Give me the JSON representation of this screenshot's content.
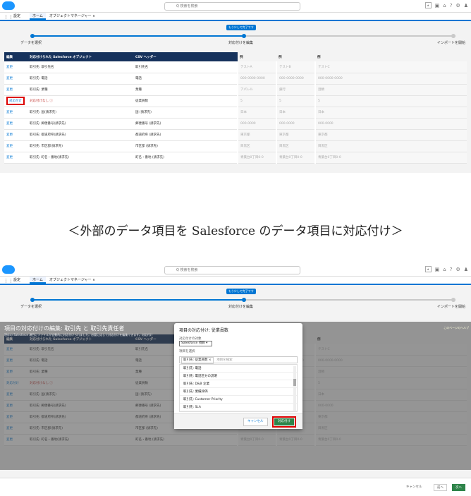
{
  "header": {
    "search_placeholder": "Q 検索を検索",
    "app_label": "設定",
    "tab_home": "ホーム",
    "tab_object_manager": "オブジェクトマネージャー ∨"
  },
  "progress": {
    "tooltip": "もう少しで完了です",
    "step1": "データを選択",
    "step2": "対応付けを編集",
    "step3": "インポートを開始"
  },
  "table": {
    "headers": [
      "編集",
      "対応付けられた Salesforce オブジェクト",
      "CSV ヘッダー",
      "例",
      "例",
      "例"
    ],
    "rows": [
      [
        "変更",
        "取引先: 取引先名",
        "取引先名",
        "テストA",
        "テストB",
        "テストC"
      ],
      [
        "変更",
        "取引先: 電話",
        "電話",
        "000-0000-0000",
        "000-0000-0000",
        "000-0000-0000"
      ],
      [
        "変更",
        "取引先: 業種",
        "業種",
        "アパレル",
        "銀行",
        "酒類"
      ],
      [
        "対応付け",
        "対応付けなし ⓘ",
        "従業員数",
        "5",
        "5",
        "5"
      ],
      [
        "変更",
        "取引先: 国(請求先)",
        "国 (請求先)",
        "日本",
        "日本",
        "日本"
      ],
      [
        "変更",
        "取引先: 郵便番号(請求先)",
        "郵便番号 (請求先)",
        "000-0000",
        "000-0000",
        "000-0000"
      ],
      [
        "変更",
        "取引先: 都道府県(請求先)",
        "都道府県 (請求先)",
        "東京都",
        "東京都",
        "東京都"
      ],
      [
        "変更",
        "取引先: 市区郡(請求先)",
        "市区郡 (請求先)",
        "目黒区",
        "目黒区",
        "目黒区"
      ],
      [
        "変更",
        "取引先: 町名・番地(請求先)",
        "町名・番地 (請求先)",
        "青葉台0丁目0-0",
        "青葉台0丁目0-0",
        "青葉台0丁目0-0"
      ]
    ]
  },
  "caption": "＜外部のデータ項目を Salesforce のデータ項目に対応付け＞",
  "edit_page": {
    "title": "項目の対応付けの編集: 取引先 と 取引先責任者",
    "subtitle": "現存の Salesforce 項目にファイルが自動的に対応付けられました。必要に応じて対応付けを編集できます。対応付け",
    "help": "このページのヘルプ"
  },
  "modal": {
    "title": "項目の対応付け: 従業員数",
    "target_label": "対応付けの対象",
    "target_value": "Salesforce 項目 ▾",
    "select_label": "項目を選択",
    "selected_pill": "取引先: 従業員数",
    "search_placeholder": "項目を検索",
    "options": [
      "取引先: 電話",
      "取引先: 電話区分の説明",
      "取引先: D&B 企業",
      "取引先: 業績評価",
      "取引先: Customer Priority",
      "取引先: SLA"
    ],
    "cancel": "キャンセル",
    "map": "対応付け"
  },
  "footer": {
    "cancel": "キャンセル",
    "prev": "前へ",
    "next": "次へ"
  }
}
